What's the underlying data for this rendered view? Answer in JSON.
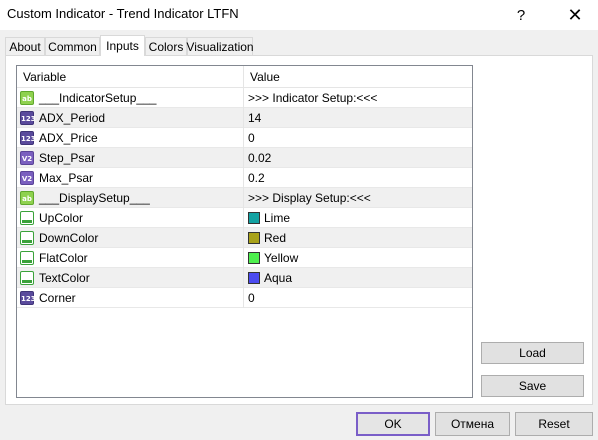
{
  "window": {
    "title": "Custom Indicator - Trend Indicator LTFN",
    "help_glyph": "?",
    "close_glyph": "✕"
  },
  "tabs": [
    {
      "label": "About"
    },
    {
      "label": "Common"
    },
    {
      "label": "Inputs",
      "active": true
    },
    {
      "label": "Colors"
    },
    {
      "label": "Visualization"
    }
  ],
  "grid": {
    "headers": {
      "variable": "Variable",
      "value": "Value"
    },
    "rows": [
      {
        "icon": "string-type-icon",
        "icon_text": "ab",
        "variable": "___IndicatorSetup___",
        "value": ">>> Indicator Setup:<<<"
      },
      {
        "icon": "integer-type-icon",
        "icon_text": "123",
        "variable": "ADX_Period",
        "value": "14"
      },
      {
        "icon": "integer-type-icon",
        "icon_text": "123",
        "variable": "ADX_Price",
        "value": "0"
      },
      {
        "icon": "double-type-icon",
        "icon_text": "V2",
        "variable": "Step_Psar",
        "value": "0.02"
      },
      {
        "icon": "double-type-icon",
        "icon_text": "V2",
        "variable": "Max_Psar",
        "value": "0.2"
      },
      {
        "icon": "string-type-icon",
        "icon_text": "ab",
        "variable": "___DisplaySetup___",
        "value": ">>> Display Setup:<<<"
      },
      {
        "icon": "color-type-icon",
        "variable": "UpColor",
        "value": "Lime",
        "swatch": "#13a2a2"
      },
      {
        "icon": "color-type-icon",
        "variable": "DownColor",
        "value": "Red",
        "swatch": "#a8a21a"
      },
      {
        "icon": "color-type-icon",
        "variable": "FlatColor",
        "value": "Yellow",
        "swatch": "#4ef04e"
      },
      {
        "icon": "color-type-icon",
        "variable": "TextColor",
        "value": "Aqua",
        "swatch": "#4b4bf0"
      },
      {
        "icon": "integer-type-icon",
        "icon_text": "123",
        "variable": "Corner",
        "value": "0"
      }
    ]
  },
  "buttons": {
    "load": "Load",
    "save": "Save",
    "ok": "OK",
    "cancel": "Отмена",
    "reset": "Reset"
  },
  "colors": {
    "ok_focus_border": "#7a5ec8",
    "grid_border": "#828790"
  }
}
